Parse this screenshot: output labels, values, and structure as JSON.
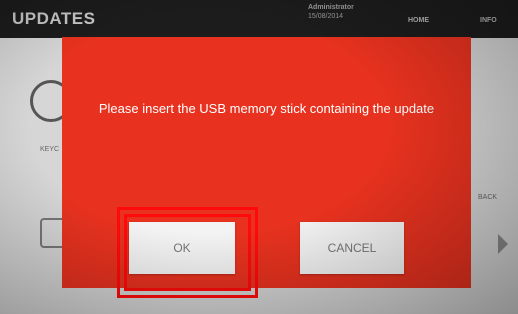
{
  "header": {
    "title": "UPDATES",
    "user_name": "Administrator",
    "date": "15/08/2014",
    "nav_home": "HOME",
    "nav_info": "INFO"
  },
  "background": {
    "left_label": "KEYC",
    "right_label": "BACK"
  },
  "dialog": {
    "message": "Please insert the USB memory stick containing the update",
    "ok_label": "OK",
    "cancel_label": "CANCEL",
    "background_color": "#e8321f",
    "highlight_color": "#ff0a0a"
  },
  "icons": {
    "refresh": "refresh-icon",
    "device": "device-icon",
    "arrow": "arrow-right-icon"
  }
}
